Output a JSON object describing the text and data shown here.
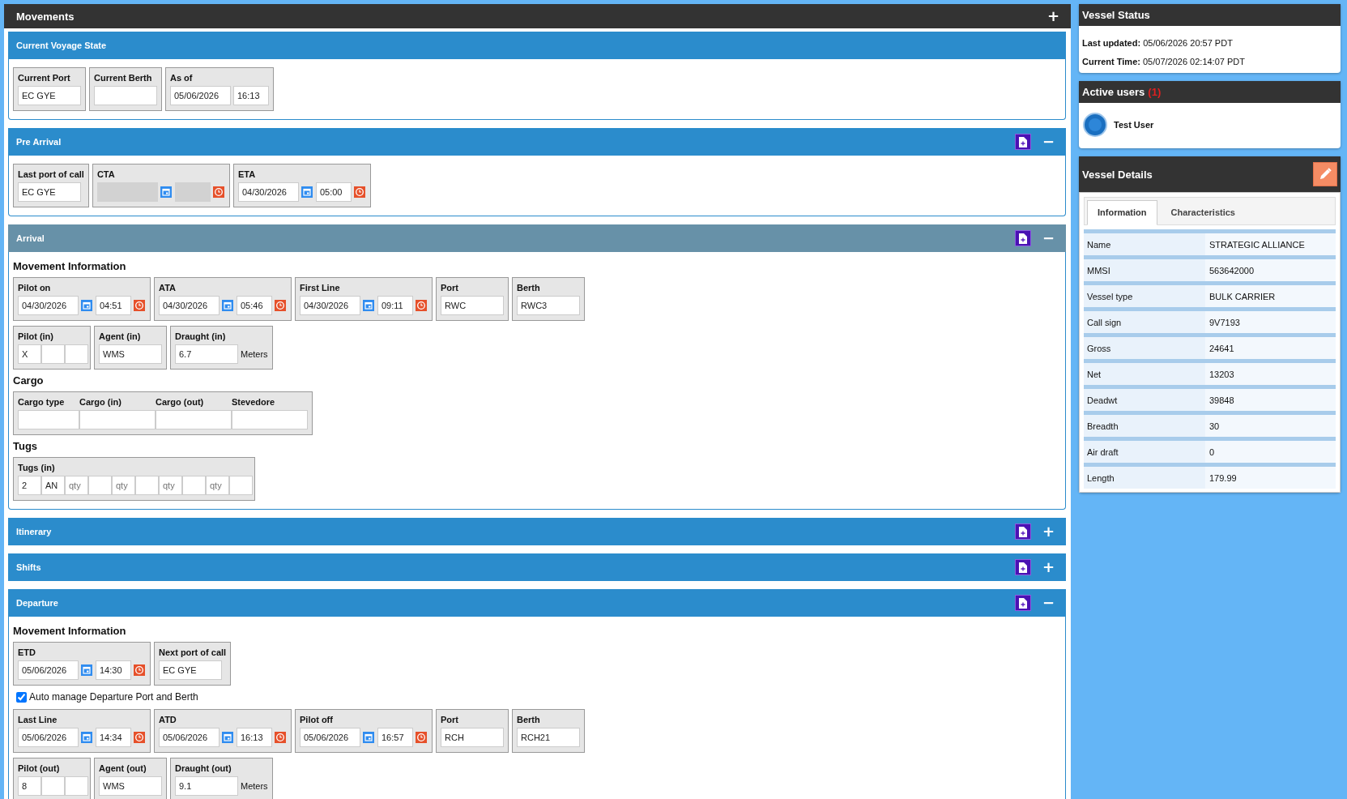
{
  "movements": {
    "title": "Movements",
    "toggle": "+",
    "sections": [
      {
        "title": "Current Voyage State",
        "active": false,
        "document_button": false,
        "blocks": [
          {
            "kind": "row",
            "groups": [
              {
                "label": "Current Port",
                "fields": [
                  {
                    "kind": "text",
                    "value": "EC GYE"
                  }
                ]
              },
              {
                "label": "Current Berth",
                "fields": [
                  {
                    "kind": "text"
                  }
                ]
              },
              {
                "label": "As of",
                "fields": [
                  {
                    "kind": "date",
                    "value": "05/06/2026"
                  },
                  {
                    "kind": "time",
                    "value": "16:13"
                  }
                ]
              }
            ]
          }
        ]
      },
      {
        "title": "Pre Arrival",
        "active": false,
        "document_button": true,
        "toggle": "−",
        "blocks": [
          {
            "kind": "row",
            "groups": [
              {
                "label": "Last port of call",
                "fields": [
                  {
                    "kind": "text",
                    "value": "EC GYE"
                  }
                ]
              },
              {
                "label": "CTA",
                "fields": [
                  {
                    "kind": "date",
                    "disabled": true
                  },
                  {
                    "kind": "calendar"
                  },
                  {
                    "kind": "time",
                    "disabled": true
                  },
                  {
                    "kind": "clock"
                  }
                ]
              },
              {
                "label": "ETA",
                "fields": [
                  {
                    "kind": "date",
                    "value": "04/30/2026"
                  },
                  {
                    "kind": "calendar"
                  },
                  {
                    "kind": "time",
                    "value": "05:00"
                  },
                  {
                    "kind": "clock"
                  }
                ]
              }
            ]
          }
        ]
      },
      {
        "title": "Arrival",
        "active": true,
        "document_button": true,
        "toggle": "−",
        "blocks": [
          {
            "kind": "heading",
            "text": "Movement Information"
          },
          {
            "kind": "row",
            "groups": [
              {
                "label": "Pilot on",
                "fields": [
                  {
                    "kind": "date",
                    "value": "04/30/2026"
                  },
                  {
                    "kind": "calendar"
                  },
                  {
                    "kind": "time",
                    "value": "04:51"
                  },
                  {
                    "kind": "clock"
                  }
                ]
              },
              {
                "label": "ATA",
                "fields": [
                  {
                    "kind": "date",
                    "value": "04/30/2026"
                  },
                  {
                    "kind": "calendar"
                  },
                  {
                    "kind": "time",
                    "value": "05:46"
                  },
                  {
                    "kind": "clock"
                  }
                ]
              },
              {
                "label": "First Line",
                "fields": [
                  {
                    "kind": "date",
                    "value": "04/30/2026"
                  },
                  {
                    "kind": "calendar"
                  },
                  {
                    "kind": "time",
                    "value": "09:11"
                  },
                  {
                    "kind": "clock"
                  }
                ]
              },
              {
                "label": "Port",
                "fields": [
                  {
                    "kind": "text",
                    "value": "RWC"
                  }
                ]
              },
              {
                "label": "Berth",
                "fields": [
                  {
                    "kind": "text",
                    "value": "RWC3"
                  }
                ]
              }
            ]
          },
          {
            "kind": "row",
            "groups": [
              {
                "label": "Pilot (in)",
                "fields": [
                  {
                    "kind": "short",
                    "value": "X"
                  },
                  {
                    "kind": "short"
                  },
                  {
                    "kind": "short"
                  }
                ]
              },
              {
                "label": "Agent (in)",
                "fields": [
                  {
                    "kind": "text",
                    "value": "WMS"
                  }
                ]
              },
              {
                "label": "Draught (in)",
                "fields": [
                  {
                    "kind": "text",
                    "value": "6.7"
                  },
                  {
                    "kind": "unit",
                    "text": "Meters"
                  }
                ]
              }
            ]
          },
          {
            "kind": "heading",
            "text": "Cargo"
          },
          {
            "kind": "table",
            "columns": [
              {
                "label": "Cargo type"
              },
              {
                "label": "Cargo (in)"
              },
              {
                "label": "Cargo (out)"
              },
              {
                "label": "Stevedore"
              }
            ]
          },
          {
            "kind": "heading",
            "text": "Tugs"
          },
          {
            "kind": "row",
            "groups": [
              {
                "label": "Tugs (in)",
                "fields": [
                  {
                    "kind": "short",
                    "value": "2"
                  },
                  {
                    "kind": "short",
                    "value": "AN"
                  },
                  {
                    "kind": "short",
                    "placeholder": "qty"
                  },
                  {
                    "kind": "short"
                  },
                  {
                    "kind": "short",
                    "placeholder": "qty"
                  },
                  {
                    "kind": "short"
                  },
                  {
                    "kind": "short",
                    "placeholder": "qty"
                  },
                  {
                    "kind": "short"
                  },
                  {
                    "kind": "short",
                    "placeholder": "qty"
                  },
                  {
                    "kind": "short"
                  }
                ]
              }
            ]
          }
        ]
      },
      {
        "title": "Itinerary",
        "active": false,
        "document_button": true,
        "toggle": "+"
      },
      {
        "title": "Shifts",
        "active": false,
        "document_button": true,
        "toggle": "+"
      },
      {
        "title": "Departure",
        "active": false,
        "document_button": true,
        "toggle": "−",
        "blocks": [
          {
            "kind": "heading",
            "text": "Movement Information"
          },
          {
            "kind": "row",
            "groups": [
              {
                "label": "ETD",
                "fields": [
                  {
                    "kind": "date",
                    "value": "05/06/2026"
                  },
                  {
                    "kind": "calendar"
                  },
                  {
                    "kind": "time",
                    "value": "14:30"
                  },
                  {
                    "kind": "clock"
                  }
                ]
              },
              {
                "label": "Next port of call",
                "fields": [
                  {
                    "kind": "text",
                    "value": "EC GYE"
                  }
                ]
              }
            ]
          },
          {
            "kind": "checkbox",
            "label": "Auto manage Departure Port and Berth",
            "checked": true
          },
          {
            "kind": "row",
            "groups": [
              {
                "label": "Last Line",
                "fields": [
                  {
                    "kind": "date",
                    "value": "05/06/2026"
                  },
                  {
                    "kind": "calendar"
                  },
                  {
                    "kind": "time",
                    "value": "14:34"
                  },
                  {
                    "kind": "clock"
                  }
                ]
              },
              {
                "label": "ATD",
                "fields": [
                  {
                    "kind": "date",
                    "value": "05/06/2026"
                  },
                  {
                    "kind": "calendar"
                  },
                  {
                    "kind": "time",
                    "value": "16:13"
                  },
                  {
                    "kind": "clock"
                  }
                ]
              },
              {
                "label": "Pilot off",
                "fields": [
                  {
                    "kind": "date",
                    "value": "05/06/2026"
                  },
                  {
                    "kind": "calendar"
                  },
                  {
                    "kind": "time",
                    "value": "16:57"
                  },
                  {
                    "kind": "clock"
                  }
                ]
              },
              {
                "label": "Port",
                "fields": [
                  {
                    "kind": "text",
                    "value": "RCH"
                  }
                ]
              },
              {
                "label": "Berth",
                "fields": [
                  {
                    "kind": "text",
                    "value": "RCH21"
                  }
                ]
              }
            ]
          },
          {
            "kind": "row",
            "groups": [
              {
                "label": "Pilot (out)",
                "fields": [
                  {
                    "kind": "short",
                    "value": "8"
                  },
                  {
                    "kind": "short"
                  },
                  {
                    "kind": "short"
                  }
                ]
              },
              {
                "label": "Agent (out)",
                "fields": [
                  {
                    "kind": "text",
                    "value": "WMS"
                  }
                ]
              },
              {
                "label": "Draught (out)",
                "fields": [
                  {
                    "kind": "text",
                    "value": "9.1"
                  },
                  {
                    "kind": "unit",
                    "text": "Meters"
                  }
                ]
              }
            ]
          }
        ]
      }
    ]
  },
  "vessel_status": {
    "title": "Vessel Status",
    "lines": [
      {
        "label": "Last updated:",
        "value": "05/06/2026 20:57 PDT"
      },
      {
        "label": "Current Time:",
        "value": "05/07/2026 02:14:07 PDT"
      }
    ]
  },
  "active_users": {
    "title": "Active users",
    "count": "(1)",
    "users": [
      {
        "name": "Test User"
      }
    ]
  },
  "vessel_details": {
    "title": "Vessel Details",
    "tabs": [
      {
        "label": "Information",
        "selected": true
      },
      {
        "label": "Characteristics",
        "selected": false
      }
    ],
    "rows": [
      {
        "label": "Name",
        "value": "STRATEGIC ALLIANCE"
      },
      {
        "label": "MMSI",
        "value": "563642000"
      },
      {
        "label": "Vessel type",
        "value": "BULK CARRIER"
      },
      {
        "label": "Call sign",
        "value": "9V7193"
      },
      {
        "label": "Gross",
        "value": "24641"
      },
      {
        "label": "Net",
        "value": "13203"
      },
      {
        "label": "Deadwt",
        "value": "39848"
      },
      {
        "label": "Breadth",
        "value": "30"
      },
      {
        "label": "Air draft",
        "value": "0"
      },
      {
        "label": "Length",
        "value": "179.99"
      }
    ]
  }
}
